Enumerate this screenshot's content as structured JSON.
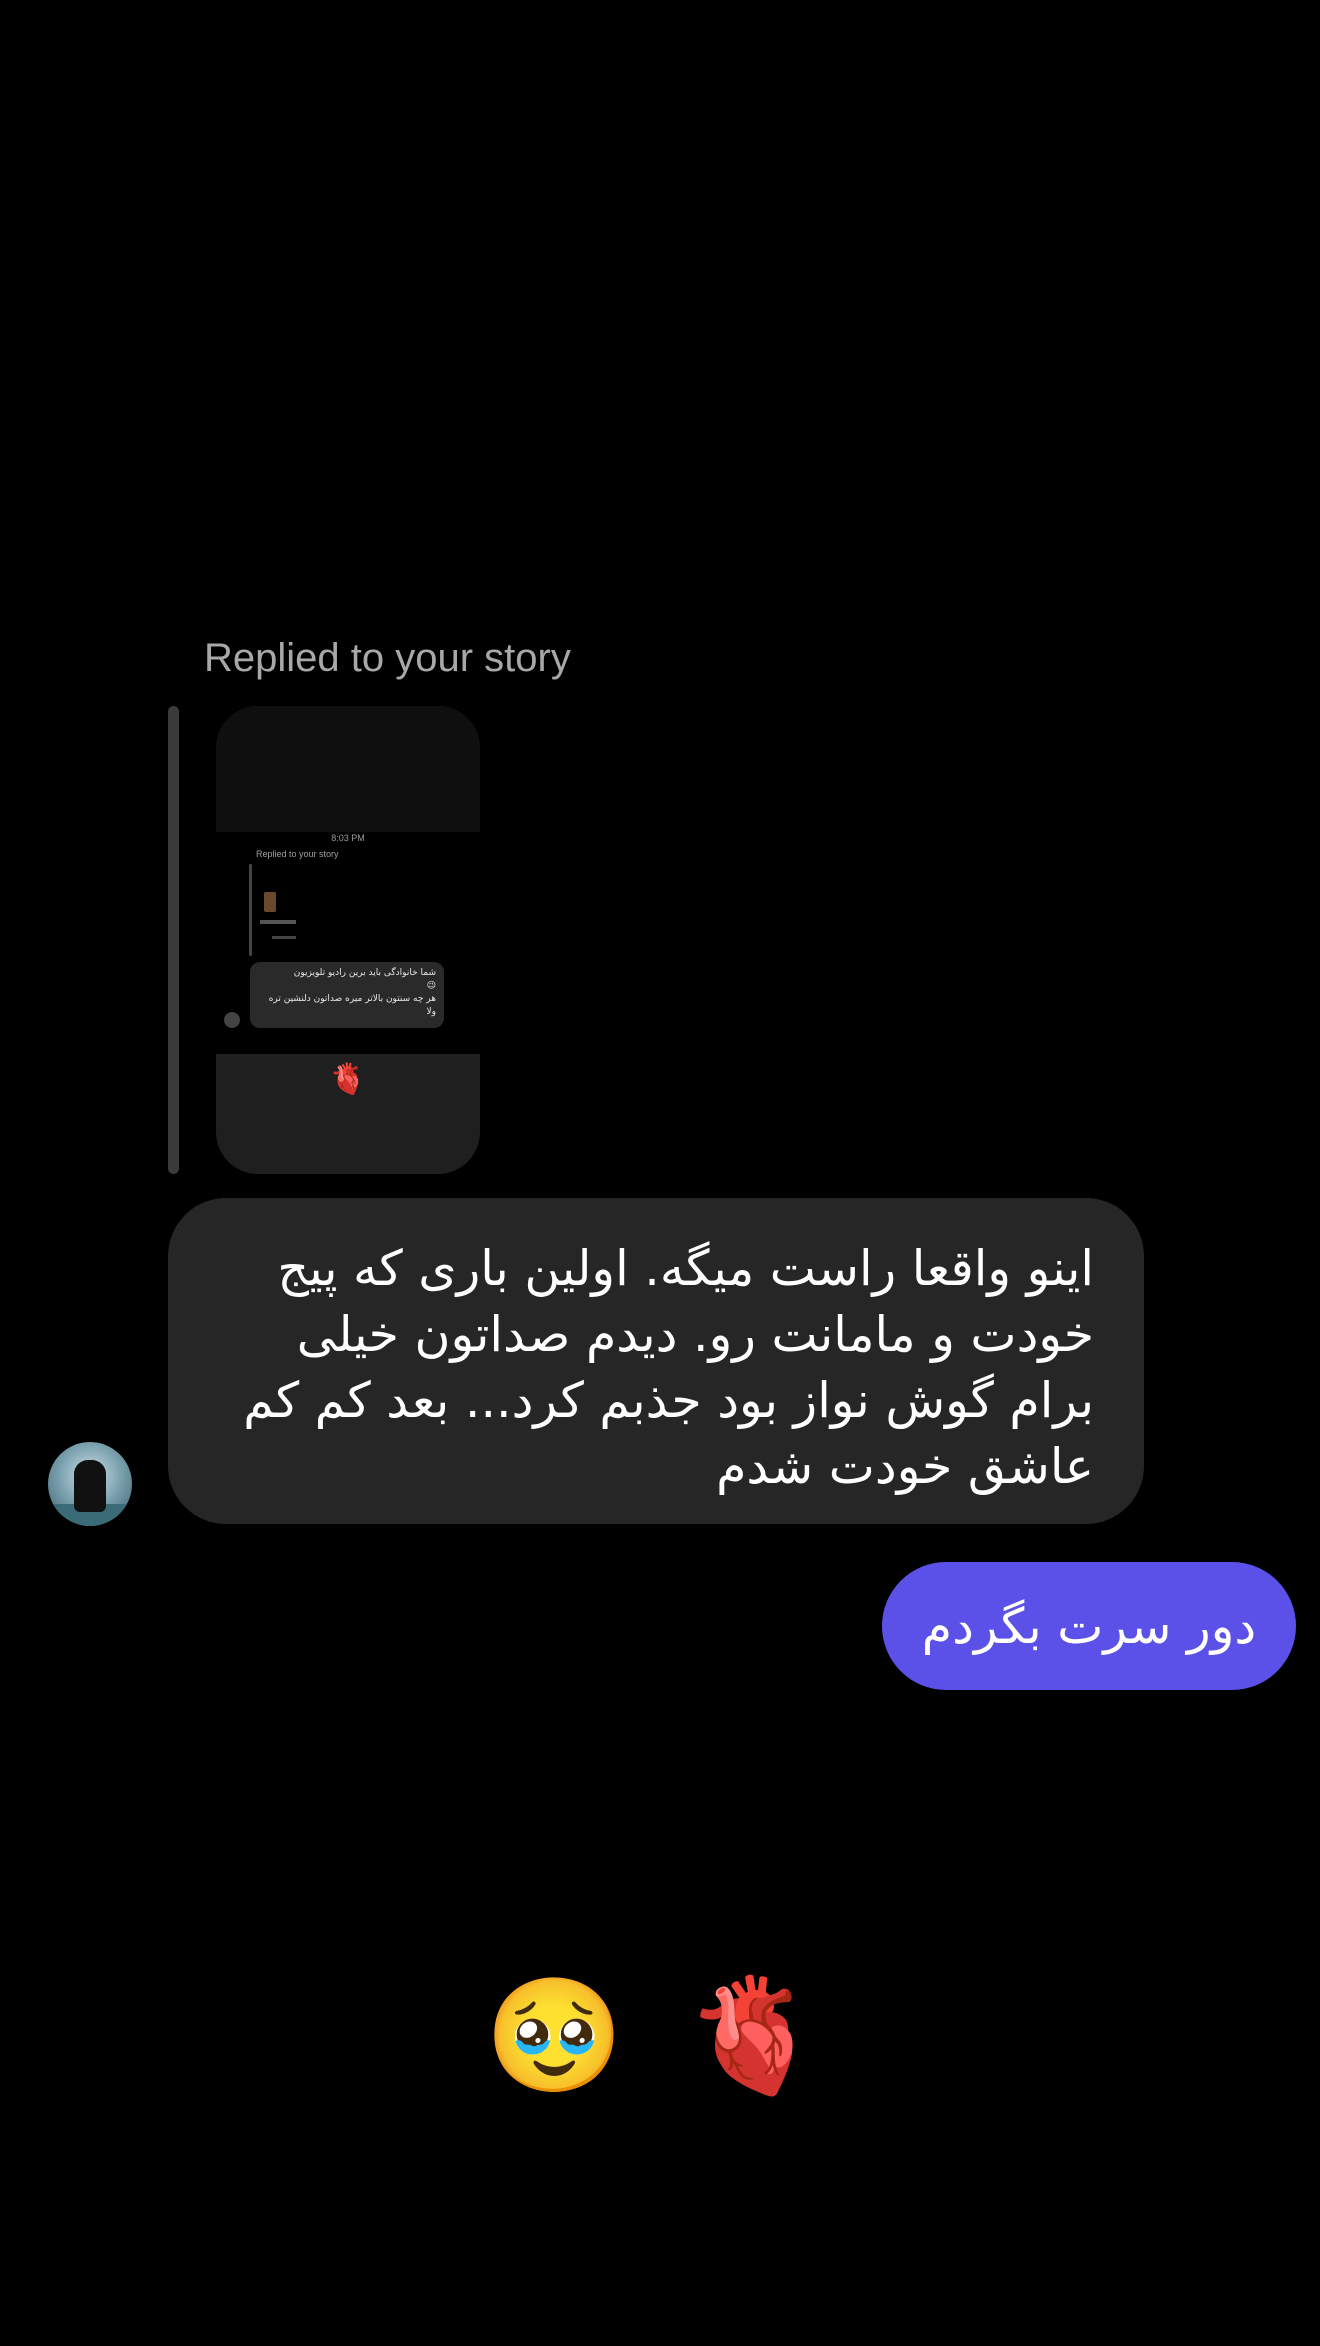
{
  "story_reply": {
    "label": "Replied to your story",
    "preview": {
      "time": "8:03 PM",
      "reply_label": "Replied to your story",
      "bubble_line1": "شما خانوادگی باید برین رادیو تلویزیون",
      "bubble_emoji": "😉",
      "bubble_line2": "هر چه سنتون بالاتر میره صداتون دلنشین تره ولا",
      "reaction": "🫀"
    }
  },
  "messages": [
    {
      "direction": "incoming",
      "text": "اینو واقعا راست میگه. اولین باری که پیج خودت و مامانت رو. دیدم   صداتون خیلی برام گوش نواز بود جذبم کرد... بعد کم کم  عاشق  خودت شدم"
    },
    {
      "direction": "outgoing",
      "text": "دور سرت بگردم"
    }
  ],
  "large_emojis": "🥹 🫀",
  "colors": {
    "background": "#000000",
    "incoming_bubble": "#262626",
    "outgoing_bubble": "#5b51e8",
    "label_text": "#a8a8a8"
  }
}
